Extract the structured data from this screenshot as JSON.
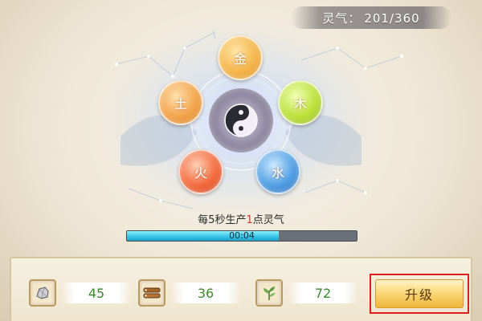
{
  "header": {
    "qi_label": "灵气：",
    "qi_value": "201/360"
  },
  "wuxing": {
    "metal": "金",
    "wood": "木",
    "earth": "土",
    "fire": "火",
    "water": "水"
  },
  "production": {
    "prefix": "每5秒生产",
    "amount": "1",
    "suffix": "点灵气",
    "timer_text": "00:04",
    "progress_fraction": 0.66
  },
  "resources": [
    {
      "icon": "stone-icon",
      "value": "45"
    },
    {
      "icon": "wood-log-icon",
      "value": "36"
    },
    {
      "icon": "herb-icon",
      "value": "72"
    }
  ],
  "actions": {
    "upgrade_label": "升级"
  },
  "colors": {
    "accent_red": "#e0312a",
    "progress_cyan": "#39c7ea",
    "value_green": "#3c8a2c",
    "highlight_frame": "#e21b1b"
  }
}
